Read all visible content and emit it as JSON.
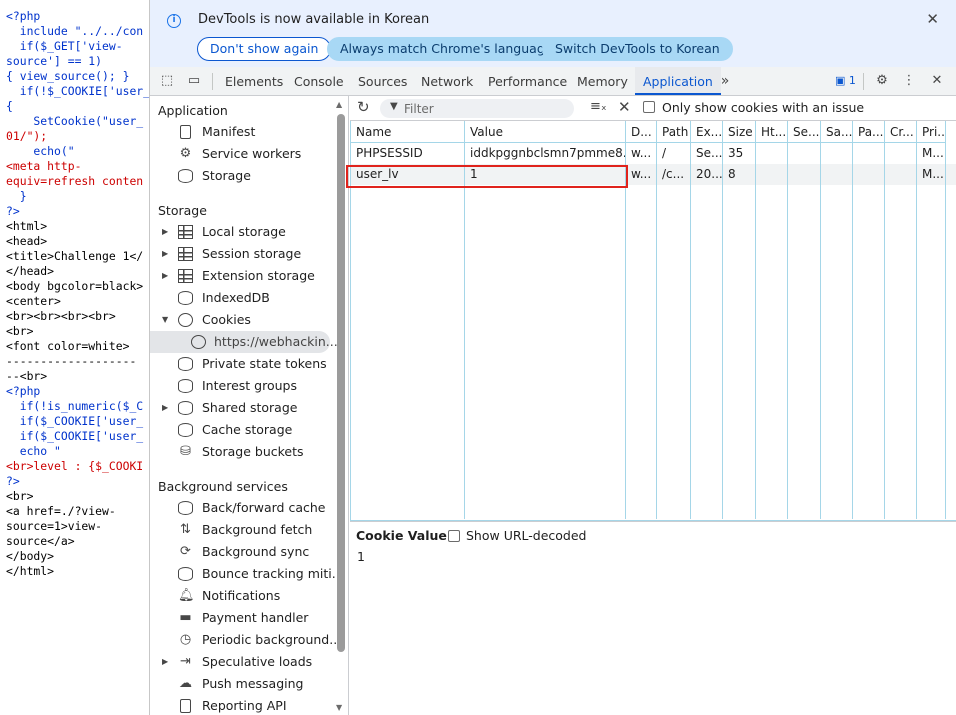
{
  "source": {
    "lines": [
      [
        {
          "t": "<?php",
          "c": "k"
        }
      ],
      [
        {
          "t": "  include \"../../con",
          "c": "k"
        }
      ],
      [
        {
          "t": "  if($_GET['view-",
          "c": "k"
        }
      ],
      [
        {
          "t": "source'] == 1)",
          "c": "k"
        }
      ],
      [
        {
          "t": "{ view_source(); }",
          "c": "k"
        }
      ],
      [
        {
          "t": "  if(!$_COOKIE['user_",
          "c": "k"
        }
      ],
      [
        {
          "t": "{",
          "c": "k"
        }
      ],
      [
        {
          "t": "    SetCookie(\"user_",
          "c": "k"
        }
      ],
      [
        {
          "t": "01/\");",
          "c": "s"
        }
      ],
      [
        {
          "t": "    echo(\"",
          "c": "k"
        }
      ],
      [
        {
          "t": "<meta http-",
          "c": "s"
        }
      ],
      [
        {
          "t": "equiv=refresh conten",
          "c": "s"
        }
      ],
      [
        {
          "t": "  }",
          "c": "k"
        }
      ],
      [
        {
          "t": "?>",
          "c": "k"
        }
      ],
      [
        {
          "t": "<html>",
          "c": "t"
        }
      ],
      [
        {
          "t": "<head>",
          "c": "t"
        }
      ],
      [
        {
          "t": "<title>Challenge 1</",
          "c": "t"
        }
      ],
      [
        {
          "t": "</head>",
          "c": "t"
        }
      ],
      [
        {
          "t": "<body bgcolor=black>",
          "c": "t"
        }
      ],
      [
        {
          "t": "<center>",
          "c": "t"
        }
      ],
      [
        {
          "t": "<br><br><br><br>",
          "c": "t"
        }
      ],
      [
        {
          "t": "<br>",
          "c": "t"
        }
      ],
      [
        {
          "t": "<font color=white>",
          "c": "t"
        }
      ],
      [
        {
          "t": "-------------------",
          "c": "t"
        }
      ],
      [
        {
          "t": "--<br>",
          "c": "t"
        }
      ],
      [
        {
          "t": "<?php",
          "c": "k"
        }
      ],
      [
        {
          "t": "  if(!is_numeric($_C",
          "c": "k"
        }
      ],
      [
        {
          "t": "  if($_COOKIE['user_",
          "c": "k"
        }
      ],
      [
        {
          "t": "  if($_COOKIE['user_",
          "c": "k"
        }
      ],
      [
        {
          "t": "  echo \"",
          "c": "k"
        }
      ],
      [
        {
          "t": "<br>level : {$_COOKI",
          "c": "s"
        }
      ],
      [
        {
          "t": "?>",
          "c": "k"
        }
      ],
      [
        {
          "t": "<br>",
          "c": "t"
        }
      ],
      [
        {
          "t": "<a href=./?view-",
          "c": "t"
        }
      ],
      [
        {
          "t": "source=1>view-",
          "c": "t"
        }
      ],
      [
        {
          "t": "source</a>",
          "c": "t"
        }
      ],
      [
        {
          "t": "</body>",
          "c": "t"
        }
      ],
      [
        {
          "t": "</html>",
          "c": "t"
        }
      ]
    ]
  },
  "infobar": {
    "message": "DevTools is now available in Korean",
    "dont_show": "Don't show again",
    "match_lang": "Always match Chrome's language",
    "switch_lang": "Switch DevTools to Korean"
  },
  "tabs": [
    "Elements",
    "Console",
    "Sources",
    "Network",
    "Performance",
    "Memory",
    "Application"
  ],
  "active_tab": "Application",
  "issues_count": "1",
  "sidebar": {
    "section_application": "Application",
    "application_items": [
      "Manifest",
      "Service workers",
      "Storage"
    ],
    "section_storage": "Storage",
    "storage_items": [
      "Local storage",
      "Session storage",
      "Extension storage",
      "IndexedDB",
      "Cookies",
      "https://webhackin...",
      "Private state tokens",
      "Interest groups",
      "Shared storage",
      "Cache storage",
      "Storage buckets"
    ],
    "section_background": "Background services",
    "background_items": [
      "Back/forward cache",
      "Background fetch",
      "Background sync",
      "Bounce tracking miti...",
      "Notifications",
      "Payment handler",
      "Periodic background...",
      "Speculative loads",
      "Push messaging",
      "Reporting API"
    ]
  },
  "toolbar": {
    "filter_placeholder": "Filter",
    "only_issue_label": "Only show cookies with an issue"
  },
  "table": {
    "headers": [
      "Name",
      "Value",
      "D...",
      "Path",
      "Ex...",
      "Size",
      "Ht...",
      "Se...",
      "Sa...",
      "Pa...",
      "Cr...",
      "Pri..."
    ],
    "rows": [
      [
        "PHPSESSID",
        "iddkpggnbclsmn7pmme8...",
        "w...",
        "/",
        "Se...",
        "35",
        "",
        "",
        "",
        "",
        "",
        "M..."
      ],
      [
        "user_lv",
        "1",
        "w...",
        "/c...",
        "20...",
        "8",
        "",
        "",
        "",
        "",
        "",
        "M..."
      ]
    ]
  },
  "preview": {
    "title": "Cookie Value",
    "url_decoded_label": "Show URL-decoded",
    "value": "1"
  },
  "colors": {
    "accent": "#0b57d0",
    "highlight": "#e0231c",
    "grid": "#a5d6e8"
  }
}
